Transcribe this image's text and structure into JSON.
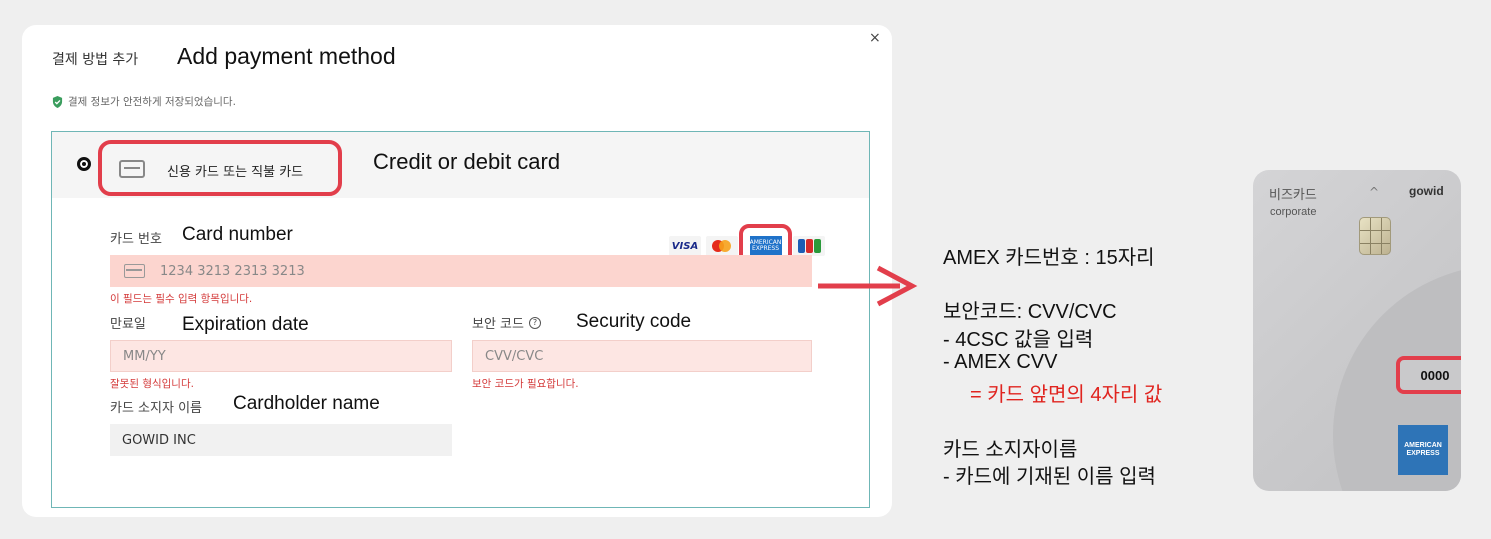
{
  "modal": {
    "title": "결제 방법 추가",
    "title_en": "Add payment method",
    "close_label": "×",
    "secure_note": "결제 정보가 안전하게 저장되었습니다."
  },
  "option": {
    "label": "신용 카드 또는 직불 카드",
    "label_en": "Credit or debit card"
  },
  "fields": {
    "card_number": {
      "label": "카드 번호",
      "label_en": "Card number",
      "value": "1234 3213 2313 3213",
      "error": "이 필드는 필수 입력 항목입니다."
    },
    "expiry": {
      "label": "만료일",
      "label_en": "Expiration date",
      "placeholder": "MM/YY",
      "error": "잘못된 형식입니다."
    },
    "security": {
      "label": "보안 코드",
      "help_icon": "?",
      "label_en": "Security code",
      "placeholder": "CVV/CVC",
      "error": "보안 코드가 필요합니다."
    },
    "holder": {
      "label": "카드 소지자 이름",
      "label_en": "Cardholder name",
      "value": "GOWID INC"
    }
  },
  "brands": {
    "visa": "VISA",
    "amex": "AMERICAN EXPRESS"
  },
  "notes": {
    "line1": "AMEX 카드번호 : 15자리",
    "line2": "보안코드: CVV/CVC",
    "line3": "-   4CSC 값을 입력",
    "line4": "-   AMEX CVV",
    "line5": "= 카드 앞면의 4자리 값",
    "line6": "카드 소지자이름",
    "line7": "-   카드에 기재된 이름 입력"
  },
  "physical_card": {
    "brand": "비즈카드",
    "corp": "corporate",
    "chevron": "^",
    "issuer": "gowid",
    "code": "0000",
    "amex_logo": "AMERICAN EXPRESS"
  },
  "colors": {
    "highlight": "#e23e4b",
    "error_text": "#d43a3a",
    "error_bg": "#fde6e3",
    "note_red": "#e0241f"
  },
  "icons": [
    "close-icon",
    "shield-check-icon",
    "credit-card-icon",
    "help-circle-icon",
    "arrow-right-icon"
  ]
}
